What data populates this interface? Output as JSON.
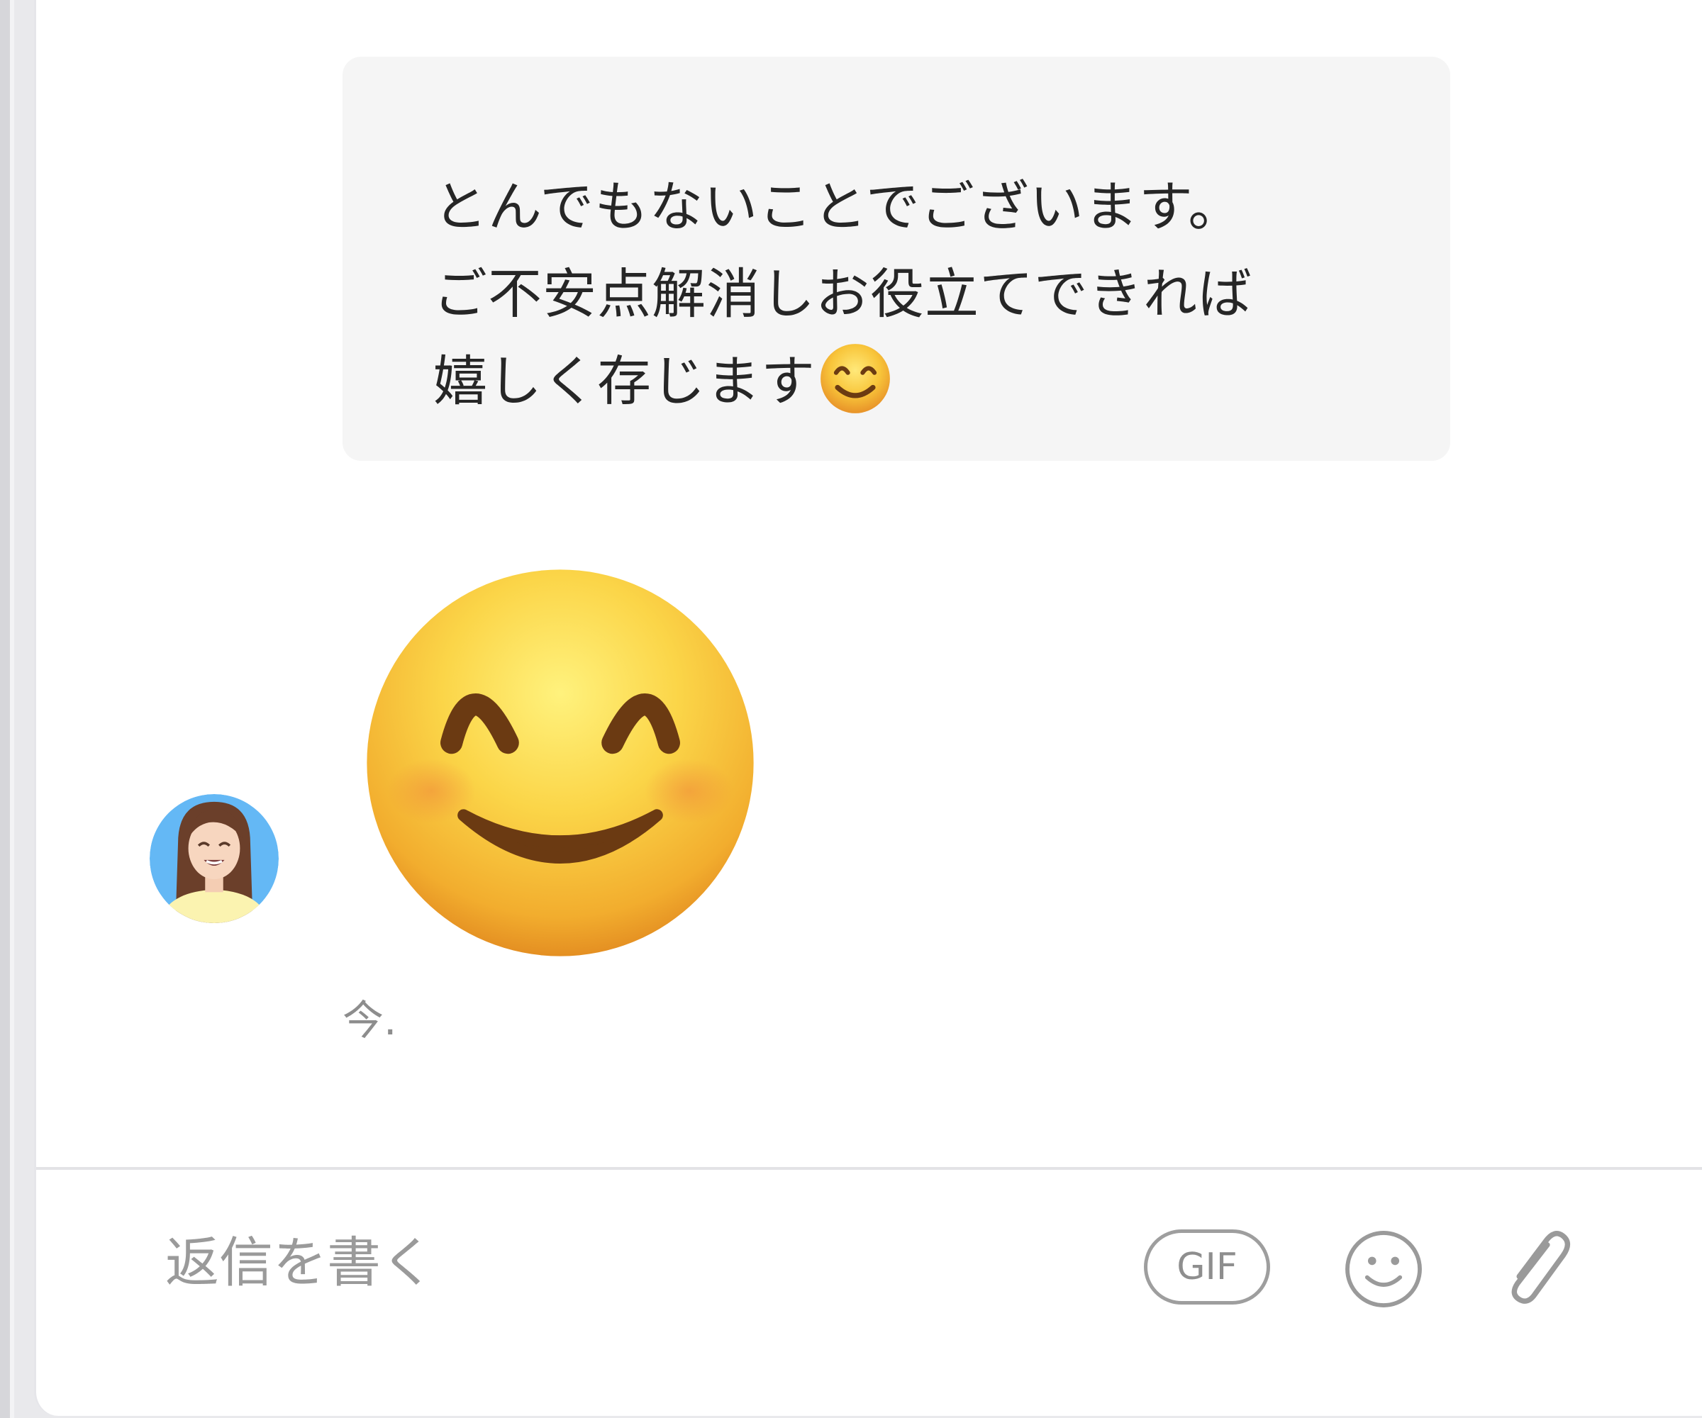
{
  "message": {
    "lines": [
      "とんでもないことでございます。",
      "ご不安点解消しお役立てできれば",
      "嬉しく存じます"
    ],
    "inline_emoji": "smiling-face-with-smiling-eyes"
  },
  "sticker": {
    "emoji": "smiling-face-with-smiling-eyes"
  },
  "sender": {
    "avatar_icon": "woman-avatar-icon"
  },
  "timestamp": "今.",
  "composer": {
    "placeholder": "返信を書く",
    "gif_label": "GIF",
    "emoji_icon": "smiley-icon",
    "attach_icon": "paperclip-icon"
  },
  "colors": {
    "bubble_bg": "#f5f5f5",
    "text": "#262626",
    "muted": "#8d8d8d",
    "avatar_bg": "#64b8f5",
    "emoji_yellow": "#f9c838"
  }
}
